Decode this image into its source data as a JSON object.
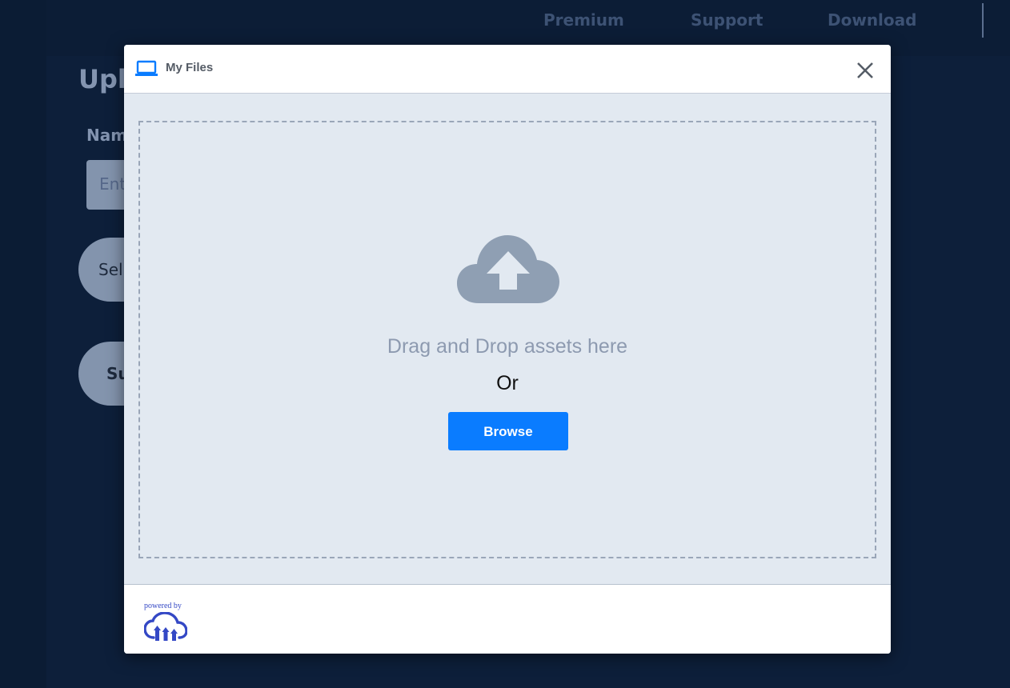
{
  "background": {
    "nav": [
      "Premium",
      "Support",
      "Download"
    ],
    "title": "Upl",
    "name_label": "Nam",
    "input_placeholder": "Ent",
    "select_button": "Sel",
    "submit_button": "Su"
  },
  "modal": {
    "title": "My Files",
    "drop_text": "Drag and Drop assets here",
    "or_text": "Or",
    "browse_label": "Browse",
    "powered_by": "powered by"
  },
  "colors": {
    "accent": "#0a7cff",
    "page_bg": "#0b1c34",
    "dropzone_bg": "#e2e9f1",
    "cloud": "#8d9ab0"
  },
  "icons": {
    "files": "laptop-icon",
    "close": "close-icon",
    "upload": "cloud-upload-icon",
    "brand": "cloudinary-logo"
  }
}
